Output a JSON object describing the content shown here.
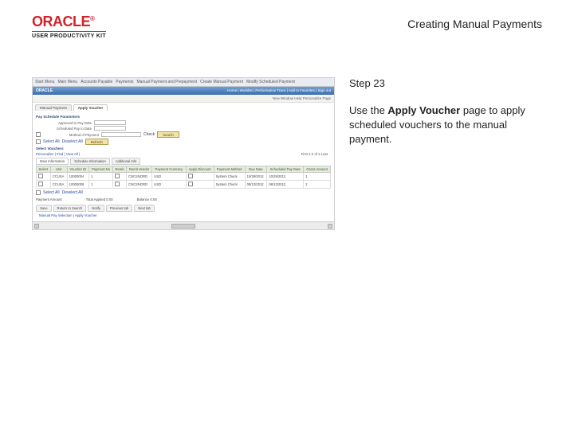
{
  "header": {
    "logo_text": "ORACLE",
    "logo_tm": "®",
    "logo_sub": "USER PRODUCTIVITY KIT",
    "topic_title": "Creating Manual Payments"
  },
  "instruction": {
    "step_label": "Step 23",
    "text_before": "Use the ",
    "bold": "Apply Voucher",
    "text_after": " page to apply scheduled vouchers to the manual payment."
  },
  "screenshot": {
    "toolbar": [
      "Start Menu",
      "Main Menu",
      "Accounts Payable",
      "Payments",
      "Manual Payment and Prepayment",
      "Create Manual Payment",
      "Modify Scheduled Payment"
    ],
    "brand": "ORACLE",
    "brand_links": "Home | Worklist | Performance Trace | Add to Favorites | Sign out",
    "subbar": "New Window  Help  Personalize Page",
    "tabs": [
      "Manual Payment",
      "Apply Voucher"
    ],
    "active_tab": 1,
    "section1": "Pay Schedule Parameters",
    "form": {
      "row1_label": "Approved to Pay Date",
      "row2_label": "Scheduled Pay to Date",
      "row3_label": "Method of Payment",
      "row3_value": "Check",
      "search_btn": "Search",
      "sel_all": "Select All",
      "deselect": "Deselect All",
      "refresh_btn": "Refresh"
    },
    "section2": "Select Vouchers",
    "grid_links": "Personalize | Find | View All |",
    "grid_count": "First 1-2 of 2 Last",
    "subtabs": [
      "Main Information",
      "Schedule Information",
      "Additional Info"
    ],
    "cols": [
      "Select",
      "Unit",
      "Voucher ID",
      "Payment No",
      "Remit",
      "Remit Vendor",
      "Payment Currency",
      "Apply Discount",
      "Payment Method",
      "Due Date",
      "Scheduled Pay Date",
      "Gross Amount"
    ],
    "rows": [
      {
        "unit": "CCUSA",
        "voucher": "10000004",
        "pay": "1",
        "remit_v": "CNCSNORD",
        "curr": "USD",
        "method": "System Check",
        "due": "10/29/2012",
        "sched": "10/29/2012",
        "amt": "1"
      },
      {
        "unit": "CCUSA",
        "voucher": "10000008",
        "pay": "1",
        "remit_v": "CNCSNORD",
        "curr": "USD",
        "method": "System Check",
        "due": "08/13/2012",
        "sched": "08/13/2012",
        "amt": "2"
      }
    ],
    "sel_all2": "Select All",
    "deselect2": "Deselect All",
    "totals": {
      "label1": "Payment Amount",
      "label2": "Total Applied  0.00",
      "label3": "Balance  0.00"
    },
    "bottom_tabs": [
      "Save",
      "Return to Search",
      "Notify",
      "Previous tab",
      "Next tab"
    ],
    "footer": "Manual Pay Selection | Apply Voucher"
  }
}
